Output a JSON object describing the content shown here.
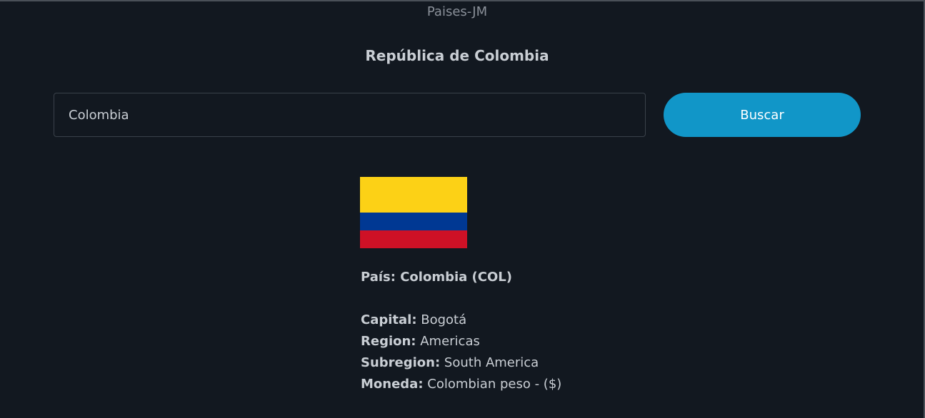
{
  "app": {
    "title": "Paises-JM"
  },
  "result": {
    "heading": "República de Colombia"
  },
  "search": {
    "value": "Colombia",
    "button_label": "Buscar"
  },
  "flag": {
    "icon": "colombia-flag",
    "colors": [
      "#fcd116",
      "#003893",
      "#ce1126"
    ]
  },
  "details": {
    "country_line": "País: Colombia (COL)",
    "capital_label": "Capital:",
    "capital_value": " Bogotá",
    "region_label": "Region:",
    "region_value": " Americas",
    "subregion_label": "Subregion:",
    "subregion_value": " South America",
    "currency_label": "Moneda:",
    "currency_value": " Colombian peso - ($)"
  },
  "colors": {
    "background": "#121820",
    "accent": "#1196c8",
    "text": "#c9ced4"
  }
}
